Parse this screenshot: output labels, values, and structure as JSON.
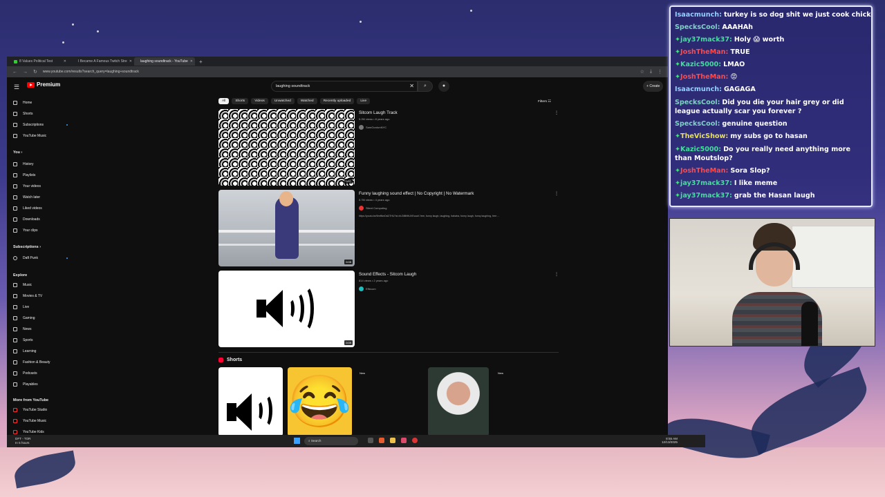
{
  "browser": {
    "tabs": [
      {
        "label": "8 Values Political Test"
      },
      {
        "label": "I Became A Famous Twitch Stre"
      },
      {
        "label": "laughing soundtrack - YouTube"
      }
    ],
    "url": "www.youtube.com/results?search_query=laughing+soundtrack"
  },
  "youtube": {
    "logo_text": "Premium",
    "search_value": "laughing soundtrack",
    "create_label": "Create",
    "sidebar": {
      "main": [
        {
          "label": "Home",
          "icon": "home-icon"
        },
        {
          "label": "Shorts",
          "icon": "shorts-icon"
        },
        {
          "label": "Subscriptions",
          "icon": "subscriptions-icon"
        },
        {
          "label": "YouTube Music",
          "icon": "music-icon"
        }
      ],
      "you_heading": "You",
      "you": [
        {
          "label": "History",
          "icon": "history-icon"
        },
        {
          "label": "Playlists",
          "icon": "playlists-icon"
        },
        {
          "label": "Your videos",
          "icon": "videos-icon"
        },
        {
          "label": "Watch later",
          "icon": "clock-icon"
        },
        {
          "label": "Liked videos",
          "icon": "like-icon"
        },
        {
          "label": "Downloads",
          "icon": "download-icon"
        },
        {
          "label": "Your clips",
          "icon": "clip-icon"
        }
      ],
      "subs_heading": "Subscriptions",
      "subs": [
        {
          "label": "Daft Punk",
          "icon": "avatar-icon"
        }
      ],
      "explore_heading": "Explore",
      "explore": [
        {
          "label": "Music",
          "icon": "music-icon"
        },
        {
          "label": "Movies & TV",
          "icon": "movie-icon"
        },
        {
          "label": "Live",
          "icon": "live-icon"
        },
        {
          "label": "Gaming",
          "icon": "gaming-icon"
        },
        {
          "label": "News",
          "icon": "news-icon"
        },
        {
          "label": "Sports",
          "icon": "trophy-icon"
        },
        {
          "label": "Learning",
          "icon": "bulb-icon"
        },
        {
          "label": "Fashion & Beauty",
          "icon": "hanger-icon"
        },
        {
          "label": "Podcasts",
          "icon": "podcast-icon"
        },
        {
          "label": "Playables",
          "icon": "controller-icon"
        }
      ],
      "more_heading": "More from YouTube",
      "more": [
        {
          "label": "YouTube Studio",
          "icon": "studio-icon"
        },
        {
          "label": "YouTube Music",
          "icon": "music-icon"
        },
        {
          "label": "YouTube Kids",
          "icon": "kids-icon"
        }
      ]
    },
    "chips": [
      "All",
      "Shorts",
      "Videos",
      "Unwatched",
      "Watched",
      "Recently uploaded",
      "Live"
    ],
    "filters_label": "Filters",
    "results": [
      {
        "title": "Sitcom Laugh Track",
        "meta": "5.2M views • 8 years ago",
        "channel": "SamGordonNYC",
        "duration": "0:57",
        "desc": ""
      },
      {
        "title": "Funny laughing sound effect | No Copyright | No Watermark",
        "meta": "5.7M views • 4 years ago",
        "channel": "Silent Computing",
        "duration": "0:05",
        "desc": "https://youtu.be/5mfNmDsDTHU?si=bU3tBt9tUVEcoaX free, funny laugh, laughing, hahaha, funny laugh, funny laughing, free ..."
      },
      {
        "title": "Sound Effects - Sitcom Laugh",
        "meta": "814 views • 2 years ago",
        "channel": "Effecom",
        "duration": "0:09",
        "desc": ""
      }
    ],
    "shorts_heading": "Shorts",
    "shorts_new_label": "New"
  },
  "taskbar": {
    "weather_line1": "DFT - TOR",
    "weather_line2": "In 5 hours",
    "search_label": "Search",
    "time": "8:55 AM",
    "date": "12/13/2025"
  },
  "chat": [
    {
      "user": "Isaacmunch:",
      "text": "turkey is so dog shit we just cook chicken now",
      "color": "#8fd3ff",
      "badge": false
    },
    {
      "user": "SpecksCool:",
      "text": "AAAHAh",
      "color": "#7fd3c5",
      "badge": false
    },
    {
      "user": "jay37mack37:",
      "text": "Holy 😱 worth",
      "color": "#40e09a",
      "badge": true
    },
    {
      "user": "JoshTheMan:",
      "text": "TRUE",
      "color": "#ff4a4a",
      "badge": true
    },
    {
      "user": "Kazic5000:",
      "text": "LMAO",
      "color": "#40e09a",
      "badge": true
    },
    {
      "user": "JoshTheMan:",
      "text": "😡",
      "color": "#ff4a4a",
      "badge": true
    },
    {
      "user": "Isaacmunch:",
      "text": "GAGAGA",
      "color": "#8fd3ff",
      "badge": false
    },
    {
      "user": "SpecksCool:",
      "text": "Did you die your hair grey or did league actually scar you forever ?",
      "color": "#7fd3c5",
      "badge": false,
      "wrap": true
    },
    {
      "user": "SpecksCool:",
      "text": "genuine question",
      "color": "#7fd3c5",
      "badge": false
    },
    {
      "user": "TheVicShow:",
      "text": "my subs go to hasan",
      "color": "#e8e15a",
      "badge": true
    },
    {
      "user": "Kazic5000:",
      "text": "Do you really need anything more than Moutslop?",
      "color": "#40e09a",
      "badge": true,
      "wrap": true
    },
    {
      "user": "JoshTheMan:",
      "text": "Sora Slop?",
      "color": "#ff4a4a",
      "badge": true
    },
    {
      "user": "jay37mack37:",
      "text": "I like meme",
      "color": "#40e09a",
      "badge": true
    },
    {
      "user": "jay37mack37:",
      "text": "grab the Hasan laugh",
      "color": "#40e09a",
      "badge": true
    }
  ]
}
